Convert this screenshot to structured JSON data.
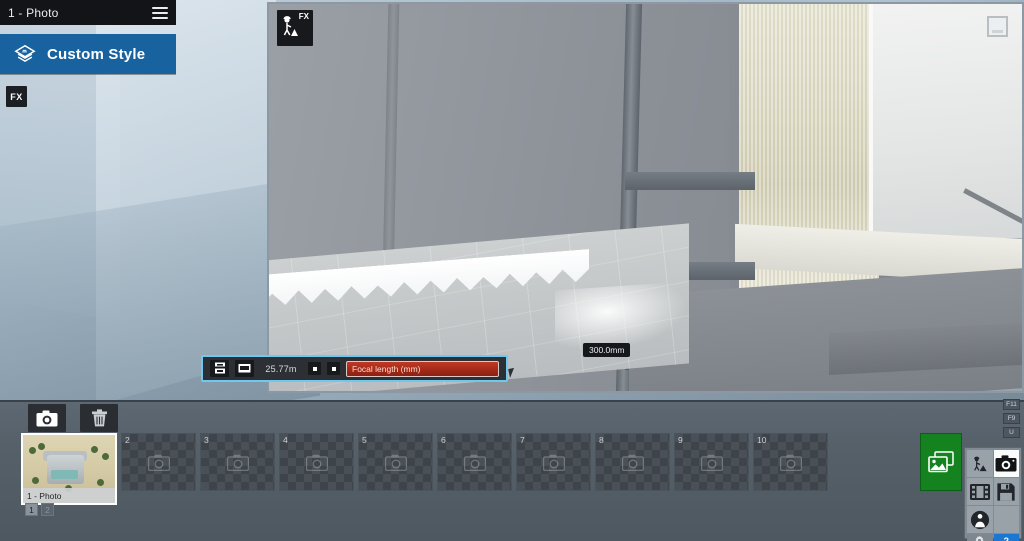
{
  "effects_panel": {
    "header_title": "1 - Photo",
    "menu_icon": "hamburger-icon",
    "style_item": {
      "label": "Custom Style",
      "icon": "layers-style-icon",
      "accent_color": "#18639f"
    },
    "fx_chip_label": "FX"
  },
  "viewport": {
    "fx_badge": {
      "label": "FX",
      "icon": "construction-worker-icon"
    },
    "corner_widget": "minimize-box-icon"
  },
  "camera_toolbar": {
    "border_color": "#6ec8f0",
    "buttons": [
      {
        "name": "depth-of-field-icon"
      },
      {
        "name": "focus-plane-icon"
      }
    ],
    "focus_distance_value": "25.77m",
    "stepper_down": "▾",
    "stepper_up": "▴",
    "slider": {
      "label": "Focal length (mm)",
      "fill_color": "#c03824",
      "fill_percent": 100
    },
    "tooltip_value": "300.0mm"
  },
  "bottom_bar": {
    "tools": [
      {
        "name": "take-photo-button",
        "icon": "camera-icon"
      },
      {
        "name": "delete-photo-button",
        "icon": "trash-icon"
      }
    ],
    "filmstrip": [
      {
        "number": "1",
        "state": "filled",
        "caption": "1 - Photo"
      },
      {
        "number": "2",
        "state": "empty",
        "caption": ""
      },
      {
        "number": "3",
        "state": "empty",
        "caption": ""
      },
      {
        "number": "4",
        "state": "empty",
        "caption": ""
      },
      {
        "number": "5",
        "state": "empty",
        "caption": ""
      },
      {
        "number": "6",
        "state": "empty",
        "caption": ""
      },
      {
        "number": "7",
        "state": "empty",
        "caption": ""
      },
      {
        "number": "8",
        "state": "empty",
        "caption": ""
      },
      {
        "number": "9",
        "state": "empty",
        "caption": ""
      },
      {
        "number": "10",
        "state": "empty",
        "caption": ""
      }
    ],
    "gallery_button": {
      "name": "render-photos-button",
      "icon": "photos-stack-icon",
      "color": "#13821f"
    },
    "page_tabs": [
      {
        "label": "1",
        "active": true
      },
      {
        "label": "2",
        "active": false
      }
    ]
  },
  "fkeys": [
    {
      "label": "F11"
    },
    {
      "label": "F9"
    },
    {
      "label": "U"
    }
  ],
  "mode_panel": {
    "cells": [
      {
        "name": "build-mode-button",
        "icon": "construction-worker-icon",
        "active": false
      },
      {
        "name": "photo-mode-button",
        "icon": "camera-icon",
        "active": true
      },
      {
        "name": "movie-mode-button",
        "icon": "film-strip-icon",
        "active": false
      },
      {
        "name": "save-button",
        "icon": "floppy-disk-icon",
        "active": false
      },
      {
        "name": "panorama-mode-button",
        "icon": "person-sphere-icon",
        "active": false
      }
    ],
    "settings_button": {
      "name": "settings-button",
      "icon": "gear-icon"
    },
    "help_button": {
      "name": "help-button",
      "label": "?",
      "color": "#1a78d2"
    }
  }
}
